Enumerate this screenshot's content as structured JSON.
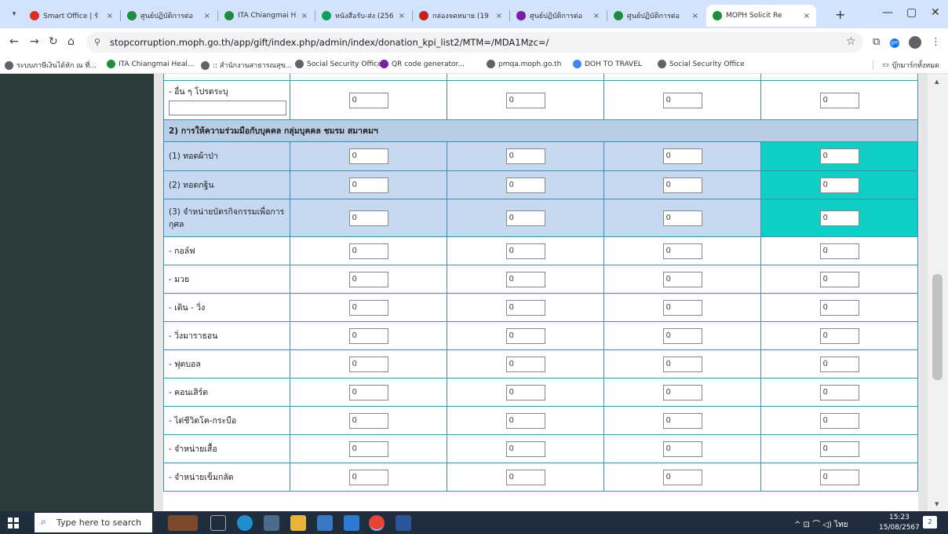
{
  "tabs": [
    {
      "label": "Smart Office | รั",
      "color": "#d93025"
    },
    {
      "label": "ศูนย์ปฏิบัติการต่อ",
      "color": "#1e8e3e"
    },
    {
      "label": "ITA Chiangmai H",
      "color": "#1e8e3e"
    },
    {
      "label": "หนังสือรับ-ส่ง (256",
      "color": "#0f9d58"
    },
    {
      "label": "กล่องจดหมาย (19",
      "color": "#c5221f"
    },
    {
      "label": "ศูนย์ปฏิบัติการต่อ",
      "color": "#7b1fa2"
    },
    {
      "label": "ศูนย์ปฏิบัติการต่อ",
      "color": "#1e8e3e"
    },
    {
      "label": "MOPH Solicit Re",
      "color": "#1e8e3e"
    }
  ],
  "tab_close": "×",
  "new_tab": "+",
  "window": {
    "minimize": "—",
    "maximize": "▢",
    "close": "✕"
  },
  "nav": {
    "back": "←",
    "forward": "→",
    "reload": "↻",
    "home": "⌂"
  },
  "address": {
    "url": "stopcorruption.moph.go.th/app/gift/index.php/admin/index/donation_kpi_list2/MTM=/MDA1Mzc=/",
    "site_icon": "⚲",
    "star": "☆"
  },
  "ext": {
    "gm": "gm",
    "puzzle": "⧉",
    "menu": "⋮"
  },
  "bookmarks": [
    {
      "label": "ระบบภาษีเงินได้หัก ณ ที่...",
      "color": "#5f6368"
    },
    {
      "label": "ITA Chiangmai Heal...",
      "color": "#1e8e3e"
    },
    {
      "label": ":: สำนักงานสาธารณสุข...",
      "color": "#5f6368"
    },
    {
      "label": "Social Security Office",
      "color": "#5f6368"
    },
    {
      "label": "QR code generator...",
      "color": "#7b1fa2"
    },
    {
      "label": "pmqa.moph.go.th",
      "color": "#5f6368"
    },
    {
      "label": "DOH TO TRAVEL",
      "color": "#4285f4"
    },
    {
      "label": "Social Security Office",
      "color": "#5f6368"
    }
  ],
  "all_bookmarks": "บุ๊กมาร์กทั้งหมด",
  "form": {
    "other_label": "- อื่น ๆ โปรดระบุ",
    "other_values": [
      "0",
      "0",
      "0",
      "0"
    ],
    "section_title": "2) การให้ความร่วมมือกับบุคคล กลุ่มบุคคล ชมรม สมาคมฯ",
    "highlight_rows": [
      {
        "label": "(1) ทอดผ้าป่า",
        "values": [
          "0",
          "0",
          "0",
          "0"
        ]
      },
      {
        "label": "(2) ทอดกฐิน",
        "values": [
          "0",
          "0",
          "0",
          "0"
        ]
      },
      {
        "label": "(3) จำหน่ายบัตรกิจกรรมเพื่อการกุศล",
        "values": [
          "0",
          "0",
          "0",
          "0"
        ]
      }
    ],
    "rows": [
      {
        "label": "- กอล์ฟ",
        "values": [
          "0",
          "0",
          "0",
          "0"
        ]
      },
      {
        "label": "- มวย",
        "values": [
          "0",
          "0",
          "0",
          "0"
        ]
      },
      {
        "label": "- เดิน - วิ่ง",
        "values": [
          "0",
          "0",
          "0",
          "0"
        ]
      },
      {
        "label": "- วิ่งมาราธอน",
        "values": [
          "0",
          "0",
          "0",
          "0"
        ]
      },
      {
        "label": "- ฟุตบอล",
        "values": [
          "0",
          "0",
          "0",
          "0"
        ]
      },
      {
        "label": "- คอนเสิร์ต",
        "values": [
          "0",
          "0",
          "0",
          "0"
        ]
      },
      {
        "label": "- ไต่ชีวิตโค-กระบือ",
        "values": [
          "0",
          "0",
          "0",
          "0"
        ]
      },
      {
        "label": "- จำหน่ายเสื้อ",
        "values": [
          "0",
          "0",
          "0",
          "0"
        ]
      },
      {
        "label": "- จำหน่ายเข็มกลัด",
        "values": [
          "0",
          "0",
          "0",
          "0"
        ]
      }
    ]
  },
  "taskbar": {
    "search_placeholder": "Type here to search",
    "search_icon": "⌕",
    "tray": "^  ⊡  ⌒  ◁)  ไทย",
    "time": "15:23",
    "date": "15/08/2567",
    "notif_count": "2"
  }
}
